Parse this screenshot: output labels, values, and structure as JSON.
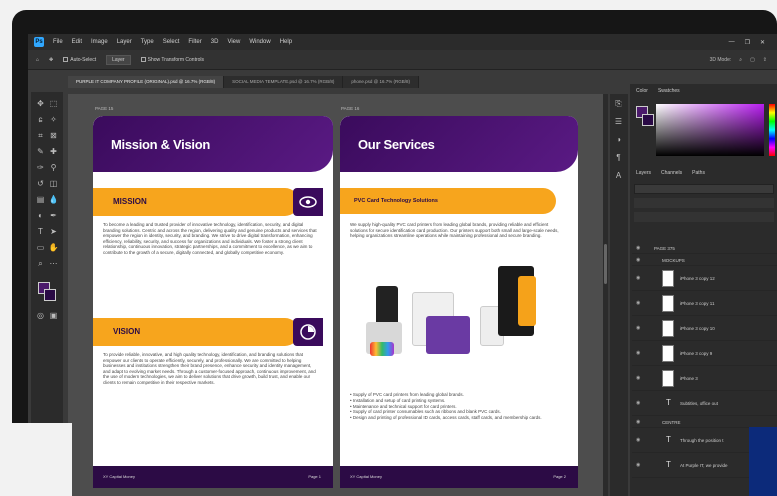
{
  "app": {
    "logo_text": "Ps",
    "menu": [
      "File",
      "Edit",
      "Image",
      "Layer",
      "Type",
      "Select",
      "Filter",
      "3D",
      "View",
      "Window",
      "Help"
    ],
    "window_controls": [
      "—",
      "❐",
      "✕"
    ]
  },
  "options_bar": {
    "auto_select_label": "Auto-Select",
    "layer_select": "Layer",
    "transform_label": "Show Transform Controls",
    "right_items": [
      "3D Mode:",
      "⌕",
      "▢",
      "⇪"
    ]
  },
  "document_tabs": [
    "PURPLE IT COMPANY PROFILE (ORIGINAL).psd @ 16.7% (RGB/8)",
    "SOCIAL MEDIA TEMPLATE.psd @ 16.7% (RGB/8)",
    "phone.psd @ 16.7% (RGB/8)"
  ],
  "pages": {
    "left": {
      "label": "PAGE 15",
      "title": "Mission & Vision",
      "mission": {
        "heading": "MISSION",
        "text": "To become a leading and trusted provider of innovative technology, identification, security, and digital branding solutions. Centric and across the region, delivering quality and genuine products and services that empower the region in identity, security, and branding. We strive to drive digital transformation, enhancing efficiency, reliability, security, and success for organizations and individuals. We foster a strong client relationship, continuous innovation, strategic partnerships, and a commitment to excellence, as we aim to contribute to the growth of a secure, digitally connected, and globally competitive economy."
      },
      "vision": {
        "heading": "VISION",
        "text": "To provide reliable, innovative, and high quality technology, identification, and branding solutions that empower our clients to operate efficiently, securely, and professionally. We are committed to helping businesses and institutions strengthen their brand presence, enhance security and identity management, and adapt to evolving market needs. Through a customer-focused approach, continuous improvement, and the use of modern technologies, we aim to deliver solutions that drive growth, build trust, and enable our clients to remain competitive in their respective markets."
      },
      "footer_left": "XY Capital Money",
      "footer_right": "Page 1"
    },
    "right": {
      "label": "PAGE 16",
      "title": "Our Services",
      "subtitle": "PVC Card Technology Solutions",
      "intro": "We supply high-quality PVC card printers from leading global brands, providing reliable and efficient solutions for secure identification card production. Our printers support both small and large-scale needs, helping organizations streamline operations while maintaining professional and secure branding.",
      "bullets": [
        "Supply of PVC card printers from leading global brands.",
        "Installation and setup of card printing systems.",
        "Maintenance and technical support for card printers.",
        "Supply of card printer consumables such as ribbons and blank PVC cards.",
        "Design and printing of professional ID cards, access cards, staff cards, and membership cards."
      ],
      "footer_left": "XY Capital Money",
      "footer_right": "Page 2"
    }
  },
  "panels": {
    "color_tabs": [
      "Color",
      "Swatches"
    ],
    "layers_tabs": [
      "Layers",
      "Channels",
      "Paths"
    ],
    "layers": [
      {
        "name": "PAGE 375",
        "type": "group"
      },
      {
        "name": "MOCKUPS",
        "type": "group"
      },
      {
        "name": "iPhone 3 copy 12",
        "type": "layer"
      },
      {
        "name": "iPhone 3 copy 11",
        "type": "layer"
      },
      {
        "name": "iPhone 3 copy 10",
        "type": "layer"
      },
      {
        "name": "iPhone 3 copy 9",
        "type": "layer"
      },
      {
        "name": "iPhone 3",
        "type": "layer"
      },
      {
        "name": "Subtitles, office out",
        "type": "text"
      },
      {
        "name": "CENTRE",
        "type": "group"
      },
      {
        "name": "Through the position t",
        "type": "text"
      },
      {
        "name": "At Purple IT, we provide",
        "type": "text"
      }
    ]
  },
  "colors": {
    "purple": "#3a0b5c",
    "orange": "#f7a51d"
  }
}
